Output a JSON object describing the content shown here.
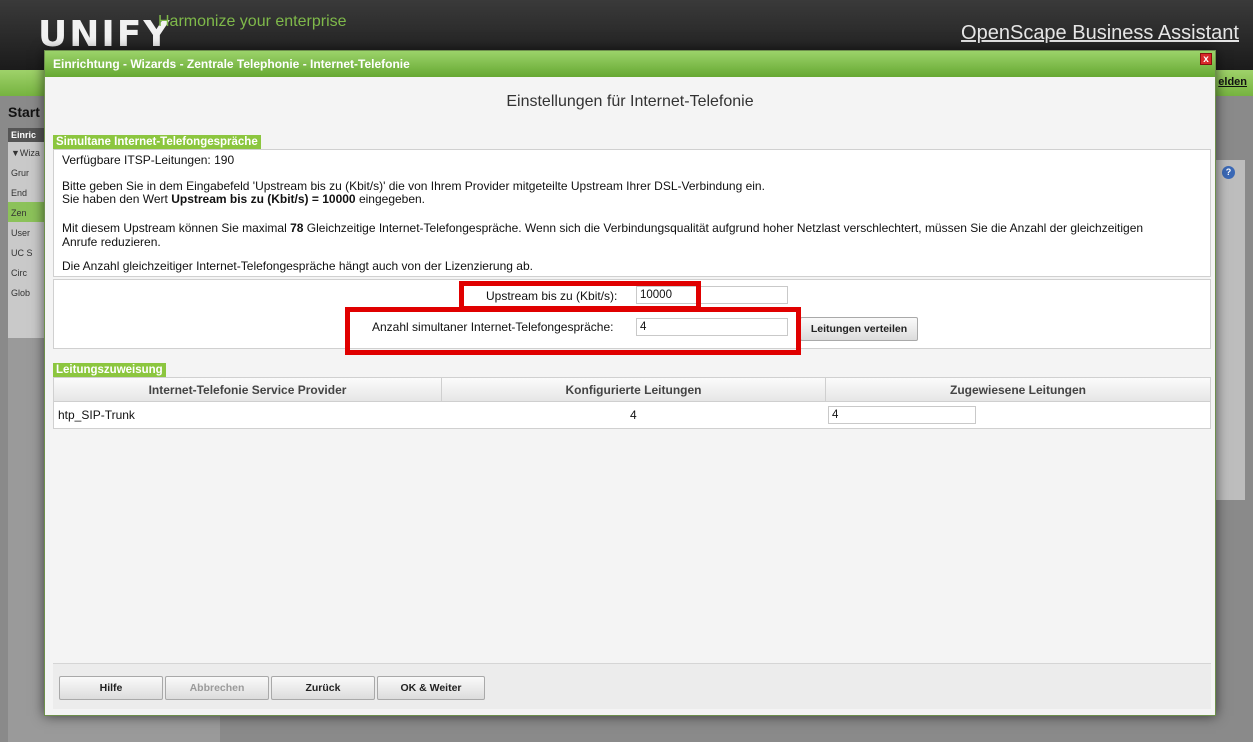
{
  "app": {
    "logo": "UNIFY",
    "logo_tagline": "Harmonize your enterprise",
    "title": "OpenScape Business Assistant",
    "logout_fragment": "elden",
    "page_start": "Start",
    "sidebar_header": "Einric",
    "sidebar_items": [
      "▼Wiza",
      "Grur",
      "End",
      "Zen",
      "User",
      "UC S",
      "Circ",
      "Glob"
    ]
  },
  "dialog": {
    "title": "Einrichtung - Wizards - Zentrale Telephonie - Internet-Telefonie",
    "close_glyph": "x",
    "heading": "Einstellungen für Internet-Telefonie"
  },
  "simultaneous": {
    "section_label": "Simultane Internet-Telefongespräche",
    "available_lines": "Verfügbare ITSP-Leitungen: 190",
    "instruction": "Bitte geben Sie in dem Eingabefeld 'Upstream bis zu (Kbit/s)' die von Ihrem Provider mitgeteilte Upstream Ihrer DSL-Verbindung ein.",
    "value_prefix": "Sie haben den Wert",
    "value_bold": "Upstream bis zu (Kbit/s) = 10000",
    "value_suffix": "eingegeben.",
    "max_prefix": "Mit diesem Upstream können Sie maximal",
    "max_number": "78",
    "max_suffix": "Gleichzeitige Internet-Telefongespräche. Wenn sich die Verbindungsqualität aufgrund hoher Netzlast verschlechtert, müssen Sie die Anzahl der gleichzeitigen",
    "max_line2": "Anrufe reduzieren.",
    "license_note": "Die Anzahl gleichzeitiger Internet-Telefongespräche hängt auch von der Lizenzierung ab.",
    "upstream_label": "Upstream bis zu (Kbit/s):",
    "upstream_value": "10000",
    "calls_label": "Anzahl simultaner Internet-Telefongespräche:",
    "calls_value": "4",
    "distribute_button": "Leitungen verteilen"
  },
  "assignment": {
    "section_label": "Leitungszuweisung",
    "columns": [
      "Internet-Telefonie Service Provider",
      "Konfigurierte Leitungen",
      "Zugewiesene Leitungen"
    ],
    "rows": [
      {
        "provider": "htp_SIP-Trunk",
        "configured": "4",
        "assigned": "4"
      }
    ]
  },
  "footer": {
    "help": "Hilfe",
    "cancel": "Abbrechen",
    "back": "Zurück",
    "ok_next": "OK & Weiter"
  },
  "colors": {
    "accent_green": "#8cc63f",
    "highlight_red": "#e00000"
  }
}
